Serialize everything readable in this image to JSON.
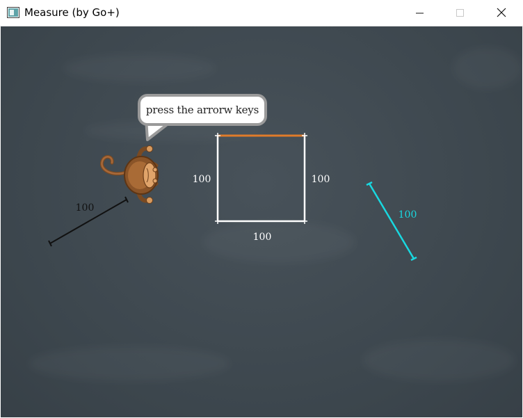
{
  "window": {
    "title": "Measure (by Go+)",
    "icons": {
      "app": "app-window-icon",
      "minimize": "minimize-icon",
      "maximize": "maximize-icon",
      "close": "close-icon"
    }
  },
  "stage": {
    "speech": {
      "text": "press the arrorw keys"
    },
    "sprite": {
      "name": "monkey"
    },
    "square": {
      "top_label": "",
      "left_label": "100",
      "right_label": "100",
      "bottom_label": "100",
      "top_edge_color": "#e07b2a",
      "edge_color": "#ffffff"
    },
    "black_line": {
      "label": "100",
      "color": "#111111"
    },
    "cyan_line": {
      "label": "100",
      "color": "#19d8e0"
    }
  }
}
